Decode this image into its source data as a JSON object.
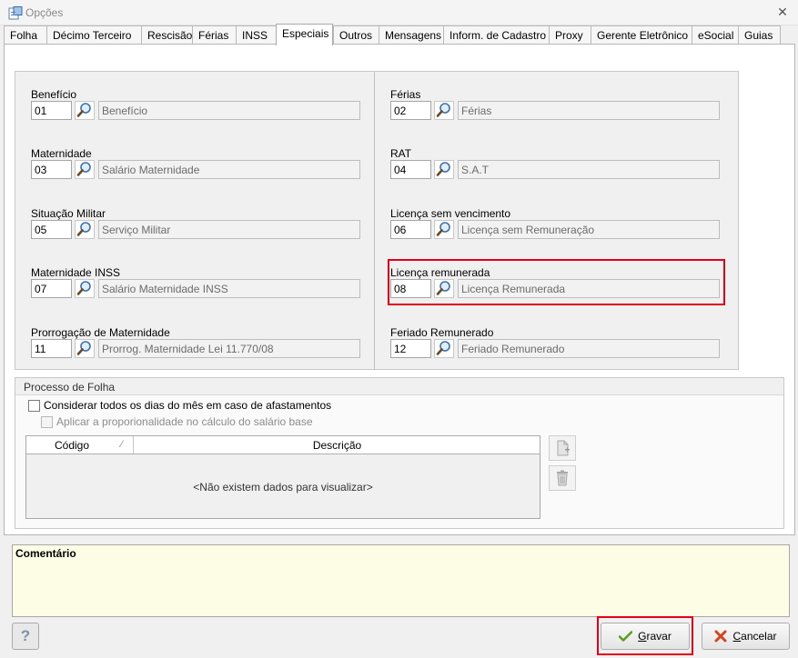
{
  "window": {
    "title": "Opções",
    "close_glyph": "✕"
  },
  "tabs": [
    {
      "label": "Folha"
    },
    {
      "label": "Décimo Terceiro"
    },
    {
      "label": "Rescisão"
    },
    {
      "label": "Férias"
    },
    {
      "label": "INSS"
    },
    {
      "label": "Especiais",
      "active": true
    },
    {
      "label": "Outros"
    },
    {
      "label": "Mensagens"
    },
    {
      "label": "Inform. de Cadastro"
    },
    {
      "label": "Proxy"
    },
    {
      "label": "Gerente Eletrônico"
    },
    {
      "label": "eSocial"
    },
    {
      "label": "Guias"
    }
  ],
  "left_fields": [
    {
      "label": "Benefício",
      "code": "01",
      "description": "Benefício"
    },
    {
      "label": "Maternidade",
      "code": "03",
      "description": "Salário Maternidade"
    },
    {
      "label": "Situação Militar",
      "code": "05",
      "description": "Serviço Militar"
    },
    {
      "label": "Maternidade INSS",
      "code": "07",
      "description": "Salário Maternidade INSS"
    },
    {
      "label": "Prorrogação de Maternidade",
      "code": "11",
      "description": "Prorrog. Maternidade Lei 11.770/08"
    }
  ],
  "right_fields": [
    {
      "label": "Férias",
      "code": "02",
      "description": "Férias"
    },
    {
      "label": "RAT",
      "code": "04",
      "description": "S.A.T"
    },
    {
      "label": "Licença sem vencimento",
      "code": "06",
      "description": "Licença sem Remuneração"
    },
    {
      "label": "Licença remunerada",
      "code": "08",
      "description": "Licença Remunerada"
    },
    {
      "label": "Feriado Remunerado",
      "code": "12",
      "description": "Feriado Remunerado"
    }
  ],
  "processo": {
    "title": "Processo de Folha",
    "chk_all_days": "Considerar todos os dias do mês em caso de afastamentos",
    "chk_proportional": "Aplicar a proporionalidade no cálculo do salário base",
    "grid": {
      "col_code": "Código",
      "col_desc": "Descrição",
      "empty": "<Não existem dados para visualizar>"
    }
  },
  "comment_label": "Comentário",
  "buttons": {
    "help": "?",
    "save_mnemonic": "G",
    "save_rest": "ravar",
    "cancel_mnemonic": "C",
    "cancel_rest": "ancelar"
  },
  "colors": {
    "highlight": "#e3001b",
    "comment_bg": "#fdfde6"
  }
}
